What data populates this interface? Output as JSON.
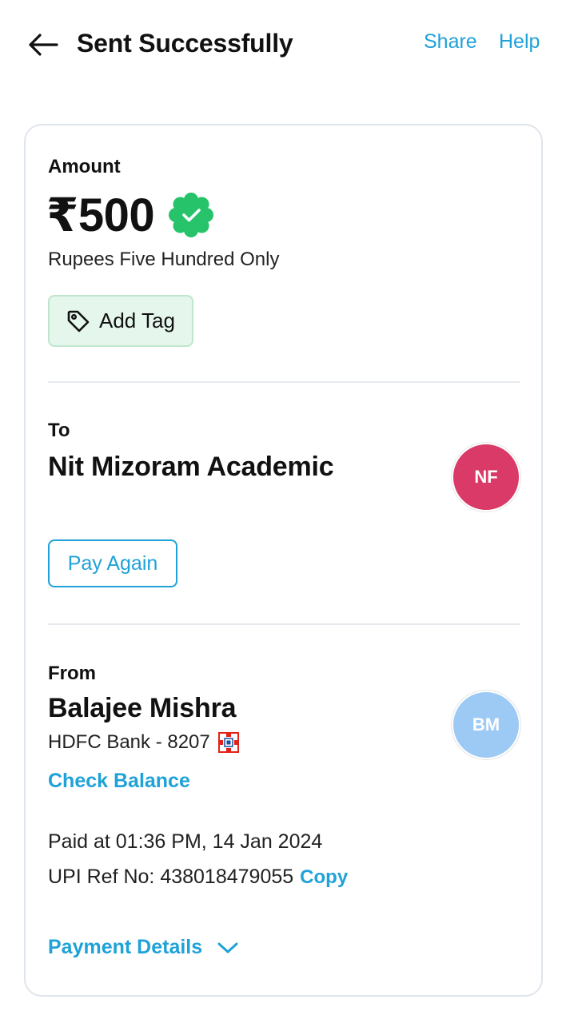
{
  "header": {
    "title": "Sent Successfully",
    "share_label": "Share",
    "help_label": "Help"
  },
  "amount": {
    "label": "Amount",
    "value": "₹500",
    "words": "Rupees Five Hundred Only",
    "add_tag_label": "Add Tag"
  },
  "to": {
    "label": "To",
    "name": "Nit Mizoram Academic",
    "initials": "NF",
    "avatar_color": "#d93a67",
    "pay_again_label": "Pay Again"
  },
  "from": {
    "label": "From",
    "name": "Balajee Mishra",
    "bank": "HDFC Bank - 8207",
    "initials": "BM",
    "avatar_color": "#9ccaf5",
    "check_balance_label": "Check Balance"
  },
  "transaction": {
    "paid_at": "Paid at 01:36 PM, 14 Jan 2024",
    "upi_ref": "UPI Ref No: 438018479055",
    "copy_label": "Copy",
    "payment_details_label": "Payment Details"
  },
  "colors": {
    "accent": "#1fa2d8",
    "success": "#27c36a"
  }
}
